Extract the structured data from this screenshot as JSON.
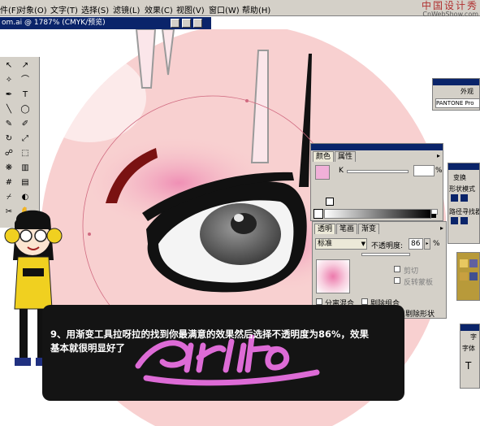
{
  "menubar": {
    "items": [
      "件(F)",
      "对象(O)",
      "文字(T)",
      "选择(S)",
      "滤镜(L)",
      "效果(C)",
      "视图(V)",
      "窗口(W)",
      "帮助(H)"
    ],
    "watermark_line1": "中国设计秀",
    "watermark_line2": "CnWebShow.com"
  },
  "document": {
    "title": "om.ai @ 1787% (CMYK/预览)"
  },
  "color_panel": {
    "tab_color": "颜色",
    "tab_attributes": "属性",
    "channel_label": "K",
    "percent_sign": "%"
  },
  "transparency_panel": {
    "tab_transparency": "透明",
    "tab_stroke": "笔画",
    "tab_gradient": "渐变",
    "blend_mode": "标准",
    "opacity_label": "不透明度:",
    "opacity_value": "86",
    "percent_sign": "%",
    "clip_label": "剪切",
    "invert_mask_label": "反转蒙板",
    "isolate_blend_label": "分离混合",
    "knockout_group_label": "剔除组合",
    "shape_knockout_label": "不透明度和蒙版用来定义剔除形状"
  },
  "right_panels": {
    "appearance_tab": "外观",
    "pantone_text": "PANTONE Pro",
    "transform_tab": "变换",
    "shape_mode_label": "形状模式",
    "pathfinder_label": "路径寻找器",
    "type_tab": "字",
    "font_label": "字体"
  },
  "caption": {
    "line1": "9、用渐变工具拉呀拉的找到你最满意的效果然后选择不透明度为86%，效果",
    "line2": "基本就很明显好了",
    "signature": "sukito"
  },
  "colors": {
    "menubar_bg": "#d4d0c8",
    "titlebar_bg": "#0a246a",
    "skin": "#f8d0d0",
    "blush": "#ec7aac",
    "signature": "#e870e0",
    "caption_bg": "#141414"
  }
}
